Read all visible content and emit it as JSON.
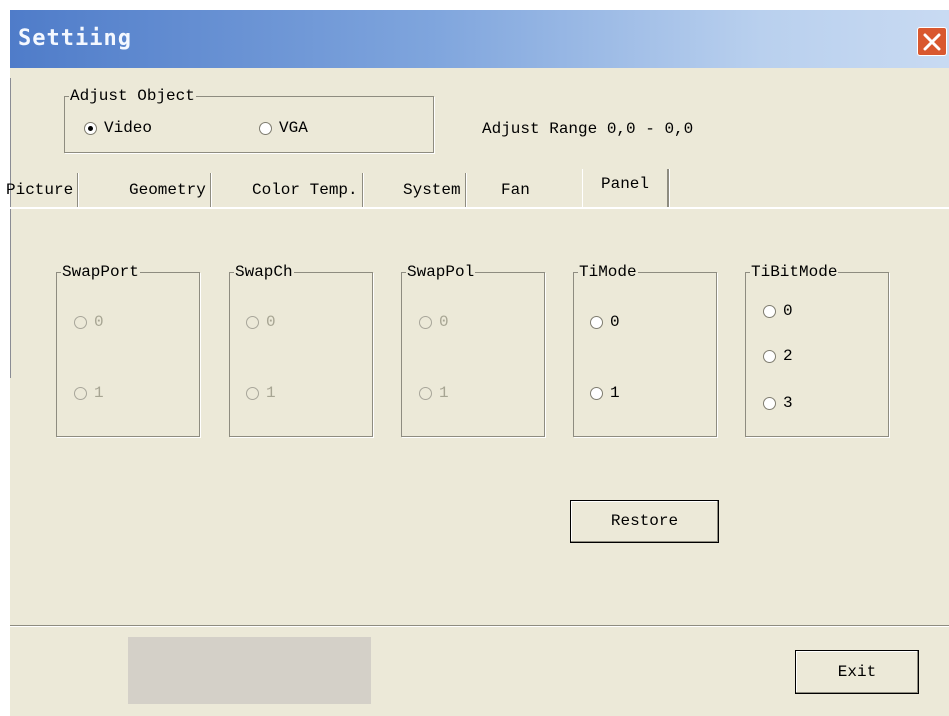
{
  "window": {
    "title": "Settiing",
    "close_label": "×"
  },
  "adjust_object": {
    "legend": "Adjust Object",
    "options": [
      {
        "label": "Video",
        "checked": true
      },
      {
        "label": "VGA",
        "checked": false
      }
    ]
  },
  "adjust_range": {
    "label": "Adjust Range",
    "value": "0,0 - 0,0"
  },
  "tabs": [
    {
      "label": "Picture",
      "active": false
    },
    {
      "label": "Geometry",
      "active": false
    },
    {
      "label": "Color Temp.",
      "active": false
    },
    {
      "label": "System",
      "active": false
    },
    {
      "label": "Fan",
      "active": false
    },
    {
      "label": "Panel",
      "active": true
    }
  ],
  "panel": {
    "groups": [
      {
        "legend": "SwapPort",
        "enabled": false,
        "options": [
          "0",
          "1"
        ]
      },
      {
        "legend": "SwapCh",
        "enabled": false,
        "options": [
          "0",
          "1"
        ]
      },
      {
        "legend": "SwapPol",
        "enabled": false,
        "options": [
          "0",
          "1"
        ]
      },
      {
        "legend": "TiMode",
        "enabled": true,
        "options": [
          "0",
          "1"
        ]
      },
      {
        "legend": "TiBitMode",
        "enabled": true,
        "options": [
          "0",
          "2",
          "3"
        ]
      }
    ],
    "restore_label": "Restore"
  },
  "footer": {
    "exit_label": "Exit"
  },
  "colors": {
    "titlebar_start": "#4f7cc9",
    "titlebar_end": "#c8daf2",
    "face": "#ece9d8",
    "close": "#d9582f"
  }
}
